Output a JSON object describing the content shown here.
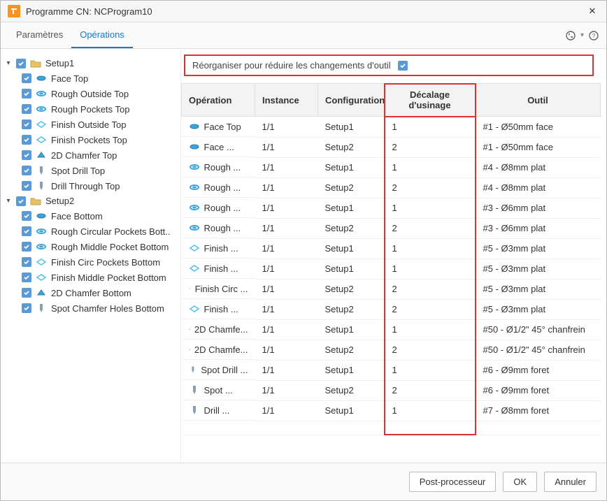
{
  "titlebar": {
    "title": "Programme CN: NCProgram10",
    "close_glyph": "✕"
  },
  "tabs": {
    "parametres": "Paramètres",
    "operations": "Opérations"
  },
  "reorder": {
    "label": "Réorganiser pour réduire les changements d'outil",
    "checked": true
  },
  "tree": [
    {
      "label": "Setup1",
      "children": [
        {
          "label": "Face Top",
          "icon": "face"
        },
        {
          "label": "Rough Outside Top",
          "icon": "rough"
        },
        {
          "label": "Rough Pockets Top",
          "icon": "rough"
        },
        {
          "label": "Finish Outside Top",
          "icon": "finish"
        },
        {
          "label": "Finish Pockets Top",
          "icon": "finish"
        },
        {
          "label": "2D Chamfer Top",
          "icon": "chamfer"
        },
        {
          "label": "Spot Drill Top",
          "icon": "drill"
        },
        {
          "label": "Drill Through Top",
          "icon": "drill"
        }
      ]
    },
    {
      "label": "Setup2",
      "children": [
        {
          "label": "Face Bottom",
          "icon": "face"
        },
        {
          "label": "Rough Circular Pockets Bott..",
          "icon": "rough"
        },
        {
          "label": "Rough Middle Pocket Bottom",
          "icon": "rough"
        },
        {
          "label": "Finish Circ Pockets Bottom",
          "icon": "finish"
        },
        {
          "label": "Finish Middle Pocket Bottom",
          "icon": "finish"
        },
        {
          "label": "2D Chamfer Bottom",
          "icon": "chamfer"
        },
        {
          "label": "Spot Chamfer Holes Bottom",
          "icon": "drill"
        }
      ]
    }
  ],
  "table": {
    "columns": {
      "operation": "Opération",
      "instance": "Instance",
      "configuration": "Configuration",
      "decalage": "Décalage d'usinage",
      "outil": "Outil"
    },
    "rows": [
      {
        "op": "Face Top",
        "icon": "face",
        "inst": "1/1",
        "conf": "Setup1",
        "dec": "1",
        "tool": "#1 - Ø50mm face"
      },
      {
        "op": "Face ...",
        "icon": "face",
        "inst": "1/1",
        "conf": "Setup2",
        "dec": "2",
        "tool": "#1 - Ø50mm face"
      },
      {
        "op": "Rough ...",
        "icon": "rough",
        "inst": "1/1",
        "conf": "Setup1",
        "dec": "1",
        "tool": "#4 - Ø8mm plat"
      },
      {
        "op": "Rough ...",
        "icon": "rough",
        "inst": "1/1",
        "conf": "Setup2",
        "dec": "2",
        "tool": "#4 - Ø8mm plat"
      },
      {
        "op": "Rough ...",
        "icon": "rough",
        "inst": "1/1",
        "conf": "Setup1",
        "dec": "1",
        "tool": "#3 - Ø6mm plat"
      },
      {
        "op": "Rough ...",
        "icon": "rough",
        "inst": "1/1",
        "conf": "Setup2",
        "dec": "2",
        "tool": "#3 - Ø6mm plat"
      },
      {
        "op": "Finish ...",
        "icon": "finish",
        "inst": "1/1",
        "conf": "Setup1",
        "dec": "1",
        "tool": "#5 - Ø3mm plat"
      },
      {
        "op": "Finish ...",
        "icon": "finish",
        "inst": "1/1",
        "conf": "Setup1",
        "dec": "1",
        "tool": "#5 - Ø3mm plat"
      },
      {
        "op": "Finish Circ ...",
        "icon": "finish",
        "inst": "1/1",
        "conf": "Setup2",
        "dec": "2",
        "tool": "#5 - Ø3mm plat"
      },
      {
        "op": "Finish ...",
        "icon": "finish",
        "inst": "1/1",
        "conf": "Setup2",
        "dec": "2",
        "tool": "#5 - Ø3mm plat"
      },
      {
        "op": "2D Chamfe...",
        "icon": "chamfer",
        "inst": "1/1",
        "conf": "Setup1",
        "dec": "1",
        "tool": "#50 - Ø1/2\" 45° chanfrein"
      },
      {
        "op": "2D Chamfe...",
        "icon": "chamfer",
        "inst": "1/1",
        "conf": "Setup2",
        "dec": "2",
        "tool": "#50 - Ø1/2\" 45° chanfrein"
      },
      {
        "op": "Spot Drill ...",
        "icon": "drill",
        "inst": "1/1",
        "conf": "Setup1",
        "dec": "1",
        "tool": "#6 - Ø9mm foret"
      },
      {
        "op": "Spot ...",
        "icon": "drill",
        "inst": "1/1",
        "conf": "Setup2",
        "dec": "2",
        "tool": "#6 - Ø9mm foret"
      },
      {
        "op": "Drill ...",
        "icon": "drill",
        "inst": "1/1",
        "conf": "Setup1",
        "dec": "1",
        "tool": "#7 - Ø8mm foret"
      }
    ]
  },
  "footer": {
    "post": "Post-processeur",
    "ok": "OK",
    "cancel": "Annuler"
  }
}
